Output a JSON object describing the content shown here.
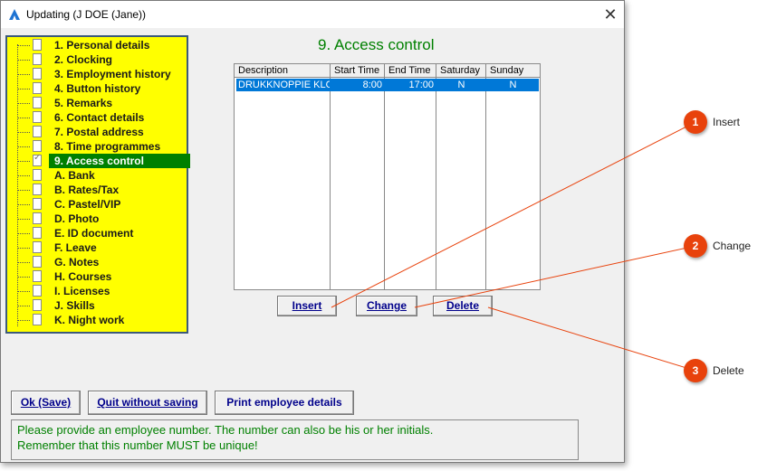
{
  "window": {
    "title": "Updating  (J DOE (Jane))",
    "close_glyph": "✕"
  },
  "tree": {
    "items": [
      {
        "label": "1. Personal details"
      },
      {
        "label": "2. Clocking"
      },
      {
        "label": "3. Employment history"
      },
      {
        "label": "4. Button history"
      },
      {
        "label": "5. Remarks"
      },
      {
        "label": "6. Contact details"
      },
      {
        "label": "7. Postal address"
      },
      {
        "label": "8. Time programmes"
      },
      {
        "label": "9. Access control"
      },
      {
        "label": "A. Bank"
      },
      {
        "label": "B. Rates/Tax"
      },
      {
        "label": "C. Pastel/VIP"
      },
      {
        "label": "D. Photo"
      },
      {
        "label": "E. ID document"
      },
      {
        "label": "F. Leave"
      },
      {
        "label": "G. Notes"
      },
      {
        "label": "H. Courses"
      },
      {
        "label": "I. Licenses"
      },
      {
        "label": "J. Skills"
      },
      {
        "label": "K. Night work"
      }
    ],
    "selected": "9. Access control"
  },
  "section_title": "9. Access control",
  "table": {
    "columns": [
      "Description",
      "Start Time",
      "End Time",
      "Saturday",
      "Sunday"
    ],
    "rows": [
      [
        "DRUKKNOPPIE KLO",
        "8:00",
        "17:00",
        "N",
        "N"
      ]
    ]
  },
  "buttons": {
    "insert": "Insert",
    "change": "Change",
    "delete": "Delete",
    "ok": "Ok (Save)",
    "quit": "Quit without saving",
    "print": "Print employee details"
  },
  "message": {
    "line1": "Please provide an employee number. The number can also be his or her initials.",
    "line2": "Remember that this number MUST be unique!"
  },
  "callouts": [
    {
      "number": "1",
      "label": "Insert"
    },
    {
      "number": "2",
      "label": "Change"
    },
    {
      "number": "3",
      "label": "Delete"
    }
  ],
  "colors": {
    "accent_green": "#008000",
    "tree_bg": "#ffff00",
    "selection_blue": "#0078d7",
    "callout_red": "#e8420c"
  },
  "icons": {
    "app": "app-logo-icon",
    "close": "close-icon",
    "document": "document-icon"
  }
}
